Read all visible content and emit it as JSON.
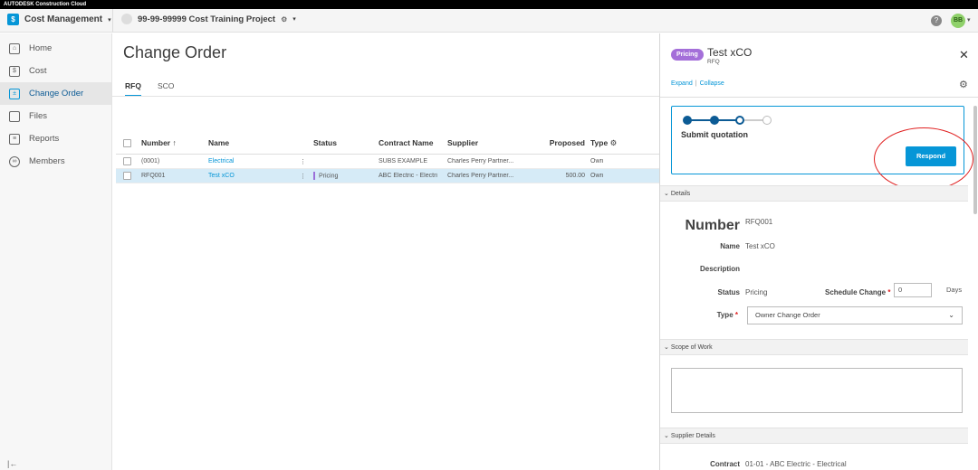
{
  "topbar": {
    "brand": "AUTODESK Construction Cloud"
  },
  "appbar": {
    "module": "Cost Management",
    "project": "99-99-99999 Cost Training Project",
    "avatar": "BB"
  },
  "sidebar": {
    "items": [
      {
        "label": "Home",
        "icon": "home-icon"
      },
      {
        "label": "Cost",
        "icon": "cost-icon"
      },
      {
        "label": "Change Order",
        "icon": "change-order-icon"
      },
      {
        "label": "Files",
        "icon": "files-icon"
      },
      {
        "label": "Reports",
        "icon": "reports-icon"
      },
      {
        "label": "Members",
        "icon": "members-icon"
      }
    ],
    "active": "Change Order"
  },
  "main": {
    "title": "Change Order",
    "tabs": [
      "RFQ",
      "SCO"
    ],
    "active_tab": "RFQ",
    "table": {
      "columns": [
        "Number",
        "Name",
        "Status",
        "Contract Name",
        "Supplier",
        "Proposed",
        "Type"
      ],
      "sort_indicator": "↑",
      "rows": [
        {
          "number": "(0001)",
          "name": "Electrical",
          "status": "",
          "contract": "SUBS EXAMPLE",
          "supplier": "Charles Perry Partner...",
          "proposed": "",
          "type": "Own"
        },
        {
          "number": "RFQ001",
          "name": "Test xCO",
          "status": "Pricing",
          "contract": "ABC Electric - Electri",
          "supplier": "Charles Perry Partner...",
          "proposed": "500.00",
          "type": "Own"
        }
      ]
    }
  },
  "panel": {
    "badge": "Pricing",
    "title": "Test xCO",
    "subtitle": "RFQ",
    "expand": "Expand",
    "collapse": "Collapse",
    "step_label": "Submit quotation",
    "respond": "Respond",
    "sections": {
      "details": "Details",
      "scope": "Scope of Work",
      "supplier": "Supplier Details"
    },
    "fields": {
      "number_label": "Number",
      "number_value": "RFQ001",
      "name_label": "Name",
      "name_value": "Test xCO",
      "description_label": "Description",
      "status_label": "Status",
      "status_value": "Pricing",
      "schedule_label": "Schedule Change",
      "schedule_value": "0",
      "schedule_unit": "Days",
      "type_label": "Type",
      "type_value": "Owner Change Order",
      "contract_label": "Contract",
      "contract_value": "01-01 - ABC Electric - Electrical"
    }
  },
  "colors": {
    "accent": "#0696d7",
    "pricing": "#a46fd9",
    "annotation": "#e02020"
  }
}
